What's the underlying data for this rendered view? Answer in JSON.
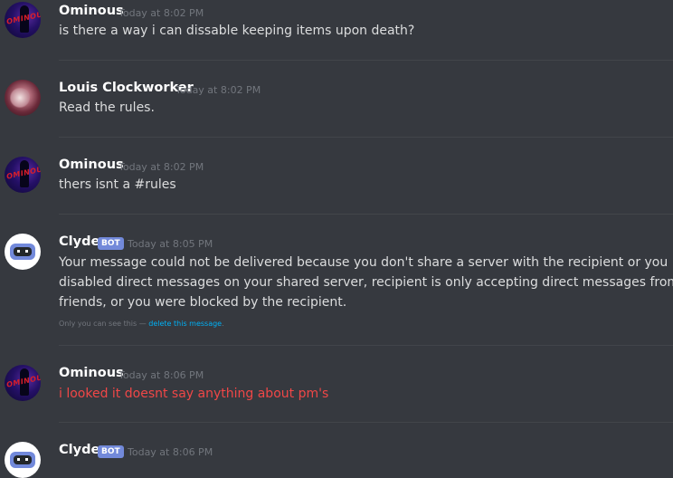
{
  "messages": [
    {
      "author": "Ominous",
      "avatar_text": "OMINOUS",
      "timestamp": "Today at 8:02 PM",
      "text": "is there a way i can dissable keeping items upon death?"
    },
    {
      "author": "Louis Clockworker",
      "timestamp": "Today at 8:02 PM",
      "text": "Read the rules."
    },
    {
      "author": "Ominous",
      "avatar_text": "OMINOUS",
      "timestamp": "Today at 8:02 PM",
      "text": "thers isnt a #rules"
    },
    {
      "author": "Clyde",
      "badge": "BOT",
      "timestamp": "Today at 8:05 PM",
      "lines": [
        "Your message could not be delivered because you don't share a server with the recipient or you",
        "disabled direct messages on your shared server, recipient is only accepting direct messages from",
        "friends, or you were blocked by the recipient."
      ],
      "note_prefix": "Only you can see this — ",
      "note_link": "delete this message",
      "note_suffix": "."
    },
    {
      "author": "Ominous",
      "avatar_text": "OMINOUS",
      "timestamp": "Today at 8:06 PM",
      "text": "i looked it doesnt say anything about pm's"
    },
    {
      "author": "Clyde",
      "badge": "BOT",
      "timestamp": "Today at 8:06 PM"
    }
  ],
  "colors": {
    "background": "#36393f",
    "username": "#ffffff",
    "message_text": "#dcddde",
    "error_text": "#f04747",
    "timestamp": "#72767d",
    "bot_badge": "#7289da",
    "link": "#00b0f4"
  }
}
